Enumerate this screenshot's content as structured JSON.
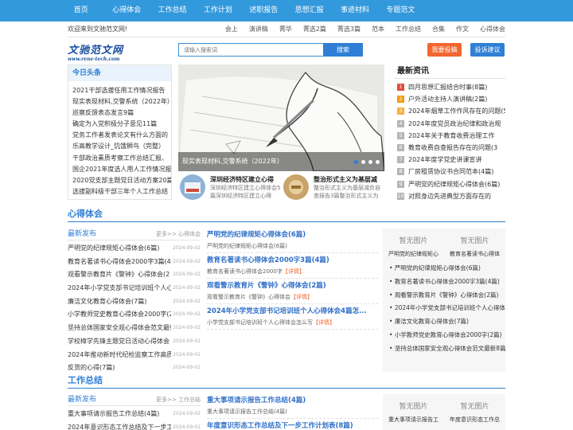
{
  "nav": [
    "首页",
    "心得体会",
    "工作总结",
    "工作计划",
    "述职报告",
    "思想汇报",
    "事迹材料",
    "专题范文"
  ],
  "infobar": {
    "welcome": "欢迎来到文驰范文网!",
    "links": [
      "会上",
      "演讲稿",
      "菁华",
      "菁选2篇",
      "菁选3篇",
      "范本",
      "工作总结",
      "合集",
      "作文",
      "心得体会"
    ]
  },
  "logo": {
    "cn": "文驰范文网",
    "en": "www.rene-tech.com"
  },
  "search": {
    "placeholder": "请输入搜索词",
    "button": "搜索"
  },
  "buttons": {
    "submit": "我要投稿",
    "suggest": "投诉建议"
  },
  "today": {
    "title": "今日头条",
    "items": [
      "2021干部选拔任用工作情况报告",
      "现实表现材料,交警系统（2022年）",
      "巡察反馈表态发言9篇",
      "确定为入党积极分子意见11篇",
      "党务工作者发表论文有什么方面的",
      "乐高教学设计_饥饿狮鸟（完整）",
      "干部政治素质考察工作总结汇报、",
      "国企2021年度选人用人工作情况报",
      "2020党支部主题党日活动方案20篇",
      "选拔副科级干部三年个人工作总结"
    ]
  },
  "slider": {
    "caption": "现实表现材料,交警系统（2022年）",
    "minis": [
      {
        "title": "深圳经济特区建立心得",
        "desc": "深圳经济特区建立心得体会5篇深圳经济特区建立心得"
      },
      {
        "title": "整治形式主义为基层减",
        "desc": "整治形式主义为基层减负自查报告3篇整治形式主义为"
      }
    ]
  },
  "news": {
    "title": "最新资讯",
    "items": [
      "四月思想汇报结合时事(8篇)",
      "户外活动主持人演讲稿(2篇)",
      "2024年烟草工作作风存在的问题(5",
      "2024年度党员政治纪律和政治规",
      "2024年关于教育收费治理工作",
      "教育收费自查报告存在的问题(3",
      "2024年度学党史讲课宣讲",
      "厂房租赁协议书合同范本(4篇)",
      "严明党的纪律规矩心得体会(6篇)",
      "对照身边先进典型方面存在的"
    ],
    "numbers": [
      "1",
      "2",
      "3",
      "4",
      "5",
      "6",
      "7",
      "8",
      "9",
      "10"
    ],
    "colors": [
      "#e84c3d",
      "#f39c12",
      "#f5b041",
      "#b5b5b5",
      "#b5b5b5",
      "#b5b5b5",
      "#b5b5b5",
      "#b5b5b5",
      "#b5b5b5",
      "#b5b5b5"
    ]
  },
  "sec1": {
    "title": "心得体会",
    "left_head": "最新发布",
    "more": "更多>> 心得体会",
    "list": [
      {
        "t": "严明党的纪律规矩心得体会(6篇)",
        "d": "2024-09-02"
      },
      {
        "t": "教育名著读书心得体会2000字3篇(4篇)",
        "d": "2024-09-02"
      },
      {
        "t": "观看警示教育片《警钟》心得体会(2",
        "d": "2024-09-02"
      },
      {
        "t": "2024年小学党支部书记培训班个人心得",
        "d": "2024-09-02"
      },
      {
        "t": "廉洁文化教育心得体会(7篇)",
        "d": "2024-09-02"
      },
      {
        "t": "小学教师党史教育心得体会2000字(2",
        "d": "2024-09-02"
      },
      {
        "t": "坚持总体国家安全观心得体会范文最新",
        "d": "2024-09-02"
      },
      {
        "t": "学校樟学先锋主题党日活动心得体会",
        "d": "2024-09-01"
      },
      {
        "t": "2024年推动新时代纪检监察工作高质量",
        "d": "2024-09-01"
      },
      {
        "t": "反货的心得(7篇)",
        "d": "2024-09-01"
      }
    ],
    "mid": [
      {
        "t": "严明党的纪律规矩心得体会(6篇)",
        "d": "严明党的纪律规矩心得体会(6篇)"
      },
      {
        "t": "教育名著读书心得体会2000字3篇(4篇)",
        "d": "教育名著读书心得体会2000字",
        "m": "【详情】"
      },
      {
        "t": "观看警示教育片《警钟》心得体会(2篇)",
        "d": "观看警示教育片《警钟》心得体会",
        "m": "【详情】"
      },
      {
        "t": "2024年小学党支部书记培训班个人心得体会4篇怎...",
        "d": "小学党支部书记培训班个人心得体会怎么写",
        "m": "【详情】"
      }
    ],
    "right": {
      "noimg": [
        "暂无图片",
        "暂无图片"
      ],
      "captions": [
        "严明党的纪律规矩心",
        "教育名著读书心得体"
      ],
      "list": [
        "严明党的纪律规矩心得体会(6篇)",
        "教育名著读书心得体会2000字3篇(4篇)",
        "观看警示教育片《警钟》心得体会(2篇)",
        "2024年小学党支部书记培训班个人心得体会4",
        "廉洁文化教育心得体会(7篇)",
        "小学教师党史教育心得体会2000字(2篇)",
        "坚持总体国家安全观心得体会范文最新8篇(4"
      ]
    }
  },
  "sec2": {
    "title": "工作总结",
    "left_head": "最新发布",
    "more": "更多>> 工作总结",
    "list": [
      {
        "t": "重大事项请示报告工作总结(4篇)",
        "d": "2024-09-02"
      },
      {
        "t": "2024年意识形态工作总结及下一步工作",
        "d": "2024-09-01"
      }
    ],
    "mid": [
      {
        "t": "重大事项请示报告工作总结(4篇)",
        "d": "重大事项请示报告工作总结(4篇)"
      },
      {
        "t": "年度意识形态工作总结及下一步工作计划表(8篇)",
        "d": ""
      }
    ],
    "right": {
      "noimg": [
        "暂无图片",
        "暂无图片"
      ],
      "captions": [
        "重大事项请示报告工",
        "年度意识形态工作总"
      ]
    }
  }
}
